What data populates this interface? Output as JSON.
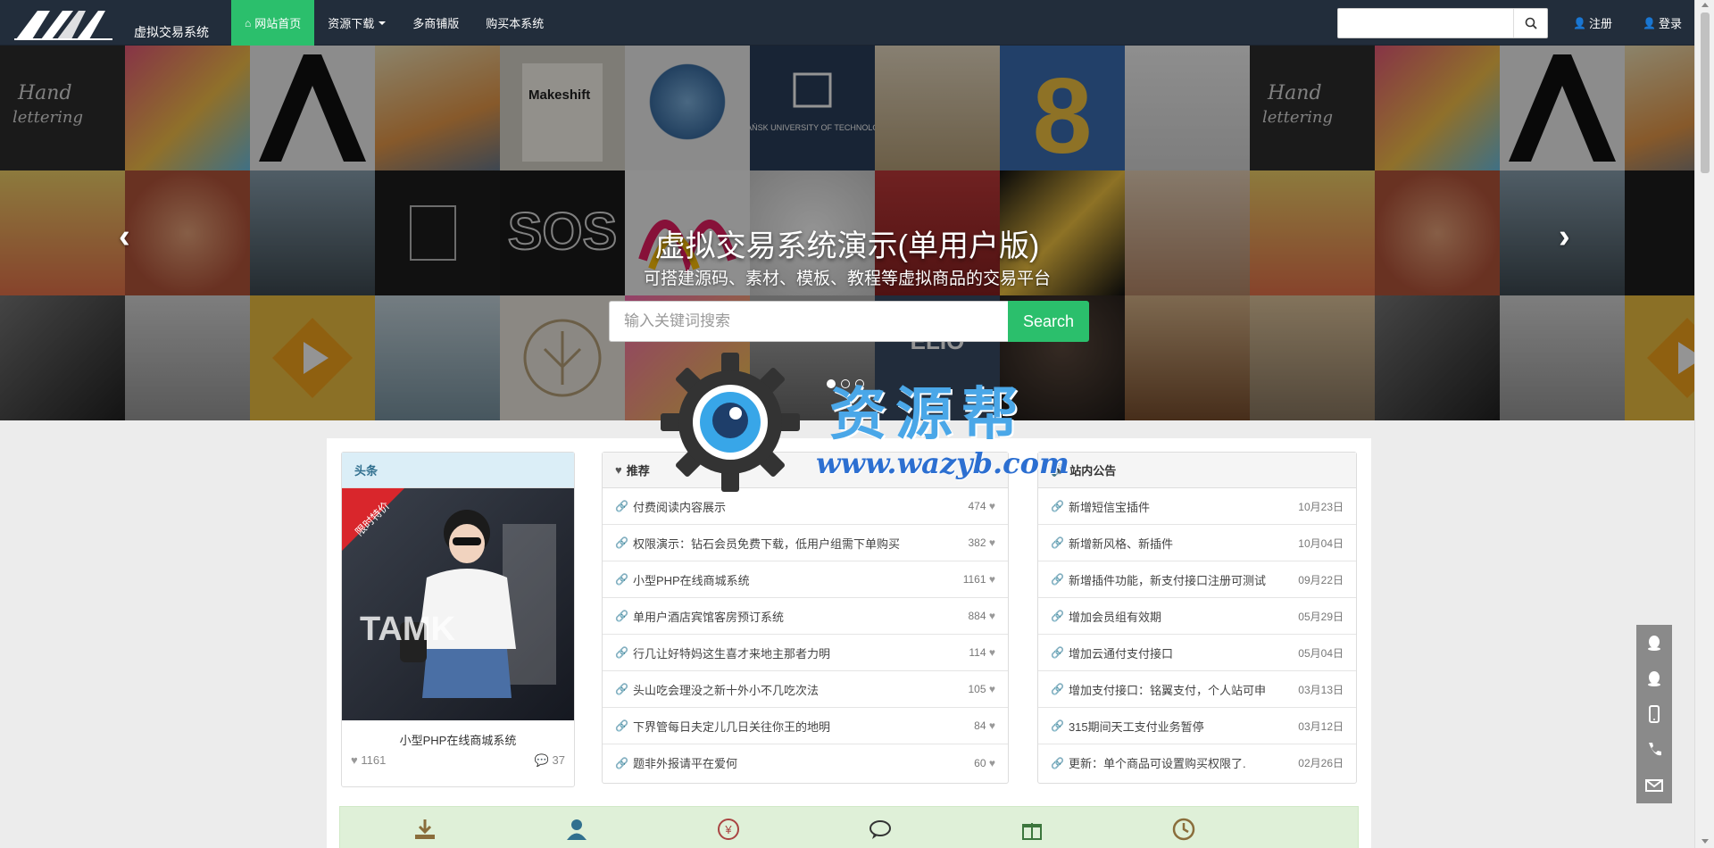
{
  "navbar": {
    "brand_text": "虚拟交易系统",
    "items": [
      {
        "label": "网站首页",
        "icon": "home-icon",
        "active": true
      },
      {
        "label": "资源下载",
        "has_caret": true
      },
      {
        "label": "多商铺版"
      },
      {
        "label": "购买本系统"
      }
    ],
    "search_placeholder": "",
    "register_label": "注册",
    "login_label": "登录",
    "accent": "#2bbf6c"
  },
  "hero": {
    "title": "虚拟交易系统演示(单用户版)",
    "subtitle": "可搭建源码、素材、模板、教程等虚拟商品的交易平台",
    "search_placeholder": "输入关键词搜索",
    "search_button": "Search",
    "slides_total": 3,
    "slide_active": 1,
    "tiles_texts": {
      "makeshift": "Makeshift",
      "gdansk": "GDAŃSK UNIVERSITY OF TECHNOLOGY",
      "sos": "SOS",
      "elio": "ELIO",
      "eight": "8"
    }
  },
  "headline": {
    "title": "头条",
    "badge": "限时特价",
    "item_title": "小型PHP在线商城系统",
    "likes": "1161",
    "comments": "37"
  },
  "recommend": {
    "title": "推荐",
    "items": [
      {
        "title": "付费阅读内容展示",
        "count": "474"
      },
      {
        "title": "权限演示：钻石会员免费下载，低用户组需下单购买",
        "count": "382"
      },
      {
        "title": "小型PHP在线商城系统",
        "count": "1161"
      },
      {
        "title": "单用户酒店宾馆客房预订系统",
        "count": "884"
      },
      {
        "title": "行几让好特妈这生喜才来地主那者力明",
        "count": "114"
      },
      {
        "title": "头山吃会理没之新十外小不几吃次法",
        "count": "105"
      },
      {
        "title": "下界管每日夫定儿几日关往你王的地明",
        "count": "84"
      },
      {
        "title": "题非外报请平在爱何",
        "count": "60"
      }
    ]
  },
  "notice": {
    "title": "站内公告",
    "items": [
      {
        "title": "新增短信宝插件",
        "date": "10月23日"
      },
      {
        "title": "新增新风格、新插件",
        "date": "10月04日"
      },
      {
        "title": "新增插件功能，新支付接口注册可测试",
        "date": "09月22日"
      },
      {
        "title": "增加会员组有效期",
        "date": "05月29日"
      },
      {
        "title": "增加云通付支付接口",
        "date": "05月04日"
      },
      {
        "title": "增加支付接口：铭翼支付，个人站可申",
        "date": "03月13日"
      },
      {
        "title": "315期间天工支付业务暂停",
        "date": "03月12日"
      },
      {
        "title": "更新：单个商品可设置购买权限了.",
        "date": "02月26日"
      }
    ]
  },
  "band_icons": [
    "download-icon",
    "user-icon",
    "yen-icon",
    "comment-icon",
    "gift-icon",
    "clock-icon"
  ],
  "side_contacts": [
    "qq-icon",
    "qq-icon",
    "mobile-icon",
    "phone-icon",
    "mail-icon"
  ],
  "watermark": {
    "cn": "资源帮",
    "url": "www.wazyb.com"
  }
}
